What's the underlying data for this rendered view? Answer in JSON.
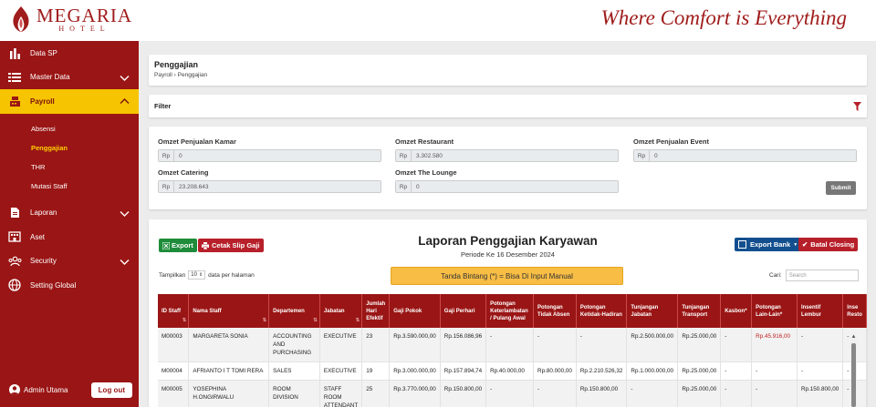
{
  "brand": {
    "name": "MEGARIA",
    "sub": "HOTEL",
    "tagline": "Where Comfort is Everything",
    "color": "#9a1515"
  },
  "sidebar": {
    "items": [
      {
        "label": "Data SP",
        "icon": "bar-chart-icon"
      },
      {
        "label": "Master Data",
        "icon": "list-icon"
      },
      {
        "label": "Payroll",
        "icon": "cash-register-icon"
      },
      {
        "label": "Laporan",
        "icon": "document-icon"
      },
      {
        "label": "Aset",
        "icon": "building-icon"
      },
      {
        "label": "Security",
        "icon": "users-icon"
      },
      {
        "label": "Setting Global",
        "icon": "globe-icon"
      }
    ],
    "payroll_sub": [
      "Absensi",
      "Penggajian",
      "THR",
      "Mutasi Staff"
    ],
    "user": "Admin Utama",
    "logout": "Log out"
  },
  "page": {
    "title": "Penggajian",
    "breadcrumb": "Payroll › Penggajian"
  },
  "filter": {
    "title": "Filter"
  },
  "form": {
    "prefix": "Rp",
    "fields": [
      {
        "label": "Omzet Penjualan Kamar",
        "value": "0"
      },
      {
        "label": "Omzet Restaurant",
        "value": "3.302.580"
      },
      {
        "label": "Omzet Penjualan Event",
        "value": "0"
      },
      {
        "label": "Omzet Catering",
        "value": "23.208.643"
      },
      {
        "label": "Omzet The Lounge",
        "value": "0"
      }
    ],
    "submit": "Submit"
  },
  "report": {
    "export": "Export",
    "print_slip": "Cetak Slip Gaji",
    "export_bank": "Export Bank",
    "batal_closing": "Batal Closing",
    "title": "Laporan Penggajian Karyawan",
    "period": "Periode Ke 16 Desember 2024",
    "note": "Tanda Bintang (*) = Bisa Di Input Manual",
    "show_prefix": "Tampilkan",
    "show_value": "10",
    "show_suffix": "data per halaman",
    "search_label": "Cari:",
    "search_placeholder": "Search"
  },
  "table": {
    "headers": [
      "ID Staff",
      "Nama Staff",
      "Departemen",
      "Jabatan",
      "Jumlah Hari Efektif",
      "Gaji Pokok",
      "Gaji Perhari",
      "Potongan Keterlambatan / Pulang Awal",
      "Potongan Tidak Absen",
      "Potongan Ketidak-Hadiran",
      "Tunjangan Jabatan",
      "Tunjangan Transport",
      "Kasbon*",
      "Potongan Lain-Lain*",
      "Insentif Lembur",
      "Inse Resto"
    ],
    "rows": [
      [
        "M00003",
        "MARGARETA SONIA",
        "ACCOUNTING AND PURCHASING",
        "EXECUTIVE",
        "23",
        "Rp.3.590.000,00",
        "Rp.156.086,96",
        "-",
        "-",
        "-",
        "Rp.2.500.000,00",
        "Rp.25.000,00",
        "-",
        "Rp.45.916,00",
        "-",
        "-"
      ],
      [
        "M00004",
        "AFRIANTO I T TOMI RERA",
        "SALES",
        "EXECUTIVE",
        "19",
        "Rp.3.000.000,00",
        "Rp.157.894,74",
        "Rp.40.000,00",
        "Rp.80.000,00",
        "Rp.2.210.526,32",
        "Rp.1.000.000,00",
        "Rp.25.000,00",
        "-",
        "-",
        "-",
        "-"
      ],
      [
        "M00005",
        "YOSEPHINA H.ONGIRWALU",
        "ROOM DIVISION",
        "STAFF ROOM ATTENDANT",
        "25",
        "Rp.3.770.000,00",
        "Rp.150.800,00",
        "-",
        "-",
        "Rp.150.800,00",
        "-",
        "Rp.25.000,00",
        "-",
        "-",
        "Rp.150.800,00",
        "-"
      ]
    ]
  }
}
